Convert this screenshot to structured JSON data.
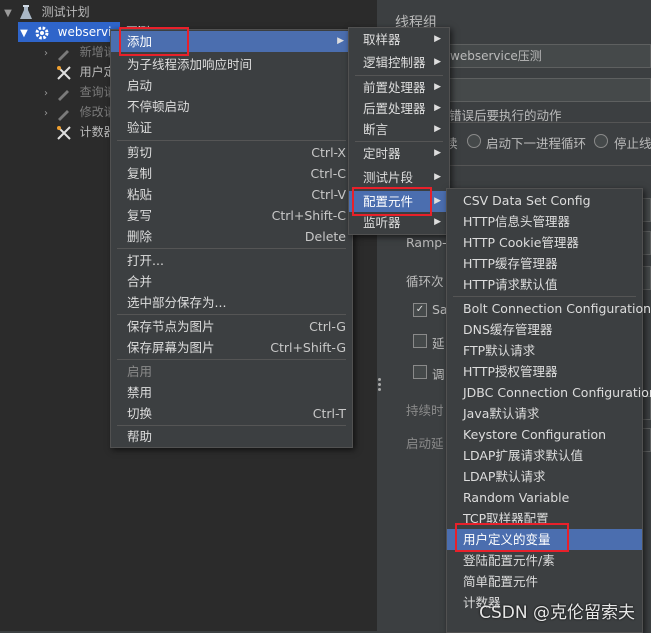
{
  "tree": {
    "plan": "测试计划",
    "group": "webservice压测",
    "children": [
      "新增请求",
      "用户定义的变量",
      "查询请求",
      "修改请求",
      "计数器"
    ]
  },
  "panel": {
    "title": "线程组",
    "name_value": "webservice压测",
    "error_action_label": "错误后要执行的动作",
    "opt_continue": "续",
    "opt_next_loop": "启动下一进程循环",
    "opt_stop": "停止线",
    "ramp_label": "Ramp-U",
    "loop_label": "循环次",
    "same_user": "Sa",
    "delay_label": "延",
    "sched_label": "调",
    "duration_label": "持续时",
    "startup_delay_label": "启动延"
  },
  "context_menu": {
    "add": "添加",
    "add_think_time": "为子线程添加响应时间",
    "start": "启动",
    "start_no_pause": "不停顿启动",
    "validate": "验证",
    "cut": "剪切",
    "cut_sc": "Ctrl-X",
    "copy": "复制",
    "copy_sc": "Ctrl-C",
    "paste": "粘贴",
    "paste_sc": "Ctrl-V",
    "duplicate": "复写",
    "duplicate_sc": "Ctrl+Shift-C",
    "delete": "删除",
    "delete_sc": "Delete",
    "open": "打开...",
    "merge": "合并",
    "save_selection": "选中部分保存为...",
    "save_node_image": "保存节点为图片",
    "save_node_image_sc": "Ctrl-G",
    "save_screen_image": "保存屏幕为图片",
    "save_screen_image_sc": "Ctrl+Shift-G",
    "enable": "启用",
    "disable": "禁用",
    "toggle": "切换",
    "toggle_sc": "Ctrl-T",
    "help": "帮助"
  },
  "add_menu": {
    "sampler": "取样器",
    "logic_controller": "逻辑控制器",
    "pre_processor": "前置处理器",
    "post_processor": "后置处理器",
    "assertion": "断言",
    "timer": "定时器",
    "test_fragment": "测试片段",
    "config_element": "配置元件",
    "listener": "监听器"
  },
  "config_menu": [
    "CSV Data Set Config",
    "HTTP信息头管理器",
    "HTTP Cookie管理器",
    "HTTP缓存管理器",
    "HTTP请求默认值",
    "Bolt Connection Configuration",
    "DNS缓存管理器",
    "FTP默认请求",
    "HTTP授权管理器",
    "JDBC Connection Configuration",
    "Java默认请求",
    "Keystore Configuration",
    "LDAP扩展请求默认值",
    "LDAP默认请求",
    "Random Variable",
    "TCP取样器配置",
    "用户定义的变量",
    "登陆配置元件/素",
    "简单配置元件",
    "计数器"
  ],
  "watermark": "CSDN @克伦留索夫",
  "colors": {
    "highlight": "#4b6eaf",
    "tree_selected": "#2f65ca",
    "annotation_red": "#e8202a"
  }
}
